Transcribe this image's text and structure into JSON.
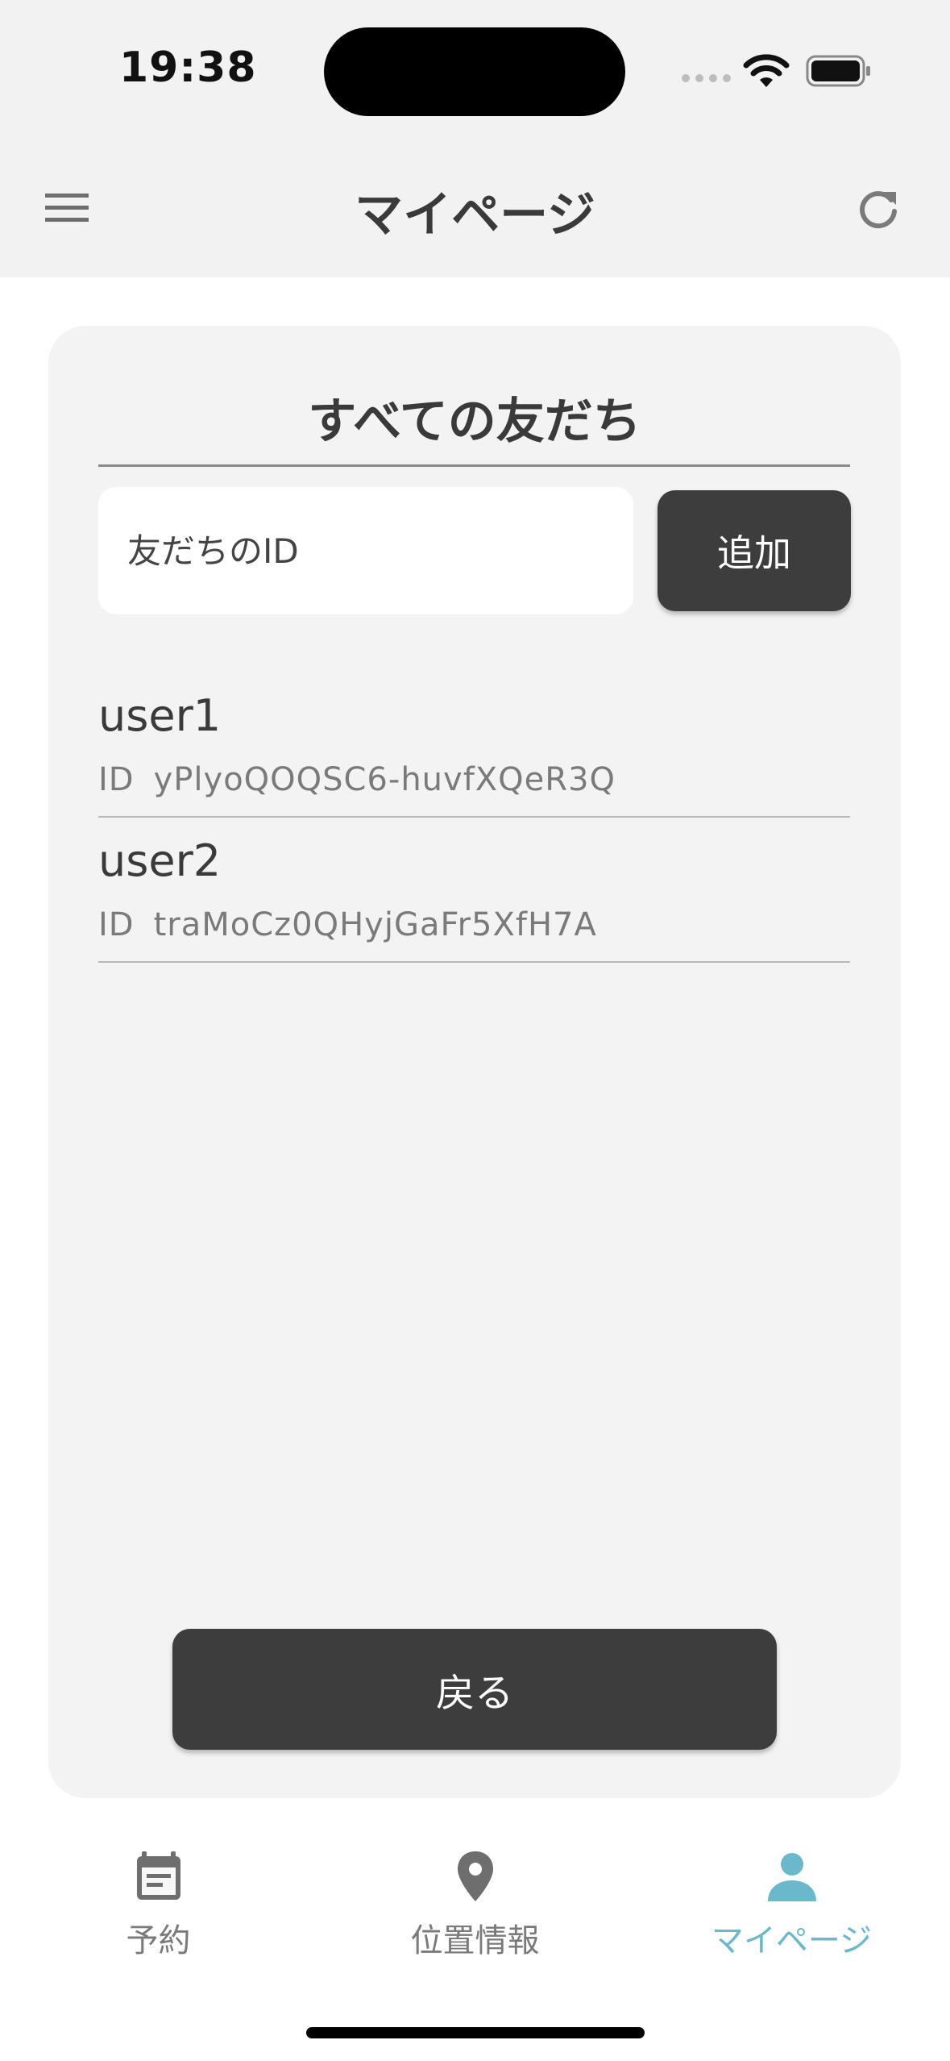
{
  "status_bar": {
    "time": "19:38"
  },
  "app_bar": {
    "title": "マイページ",
    "menu_icon": "hamburger-menu-icon",
    "refresh_icon": "refresh-icon"
  },
  "friends_card": {
    "title": "すべての友だち",
    "id_input": {
      "placeholder": "友だちのID",
      "value": ""
    },
    "add_button_label": "追加",
    "friends": [
      {
        "name": "user1",
        "id_label": "ID",
        "id": "yPlyoQOQSC6-huvfXQeR3Q"
      },
      {
        "name": "user2",
        "id_label": "ID",
        "id": "traMoCz0QHyjGaFr5XfH7A"
      }
    ],
    "back_button_label": "戻る"
  },
  "bottom_nav": {
    "items": [
      {
        "label": "予約",
        "icon": "calendar-icon",
        "active": false
      },
      {
        "label": "位置情報",
        "icon": "location-pin-icon",
        "active": false
      },
      {
        "label": "マイページ",
        "icon": "person-icon",
        "active": true
      }
    ],
    "active_color": "#6ab8c9",
    "inactive_color": "#7a7a7a"
  },
  "colors": {
    "button_bg": "#3d3d3d",
    "card_bg": "#f3f3f3",
    "appbar_bg": "#f2f2f2"
  }
}
